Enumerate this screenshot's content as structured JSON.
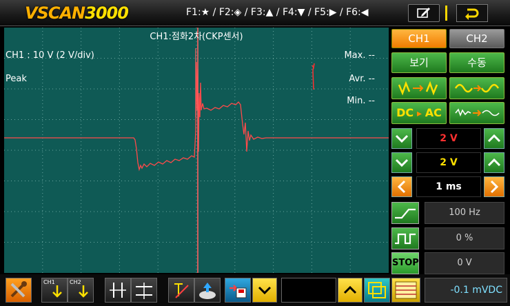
{
  "header": {
    "logo_v": "V",
    "logo_text": "SCAN",
    "logo_num": "3000",
    "fkeys": "F1:★ / F2:◈ / F3:▲ / F4:▼ / F5:▶ / F6:◀",
    "edit_icon": "edit-icon",
    "back_icon": "return-icon"
  },
  "scope": {
    "title": "CH1:점화2차(CKP센서)",
    "volt_label": "CH1 : 10 V (2 V/div)",
    "mode_label": "Peak",
    "max_label": "Max. --",
    "avr_label": "Avr. --",
    "min_label": "Min. --",
    "colors": {
      "background": "#0f5a55",
      "grid": "#6aa6a0",
      "trace": "#ff4a4a"
    }
  },
  "panel": {
    "ch1_label": "CH1",
    "ch2_label": "CH2",
    "view_label": "보기",
    "manual_label": "수동",
    "dc_label": "DC",
    "ac_label": "AC",
    "volt_ch1": "2 V",
    "volt_ch2": "2 V",
    "timebase": "1 ms",
    "trigger_freq": "100 Hz",
    "duty": "0 %",
    "stop_label": "STOP",
    "level": "0 V"
  },
  "toolbar": {
    "ch1_trig": "CH1",
    "ch2_trig": "CH2",
    "mvdc": "-0.1 mVDC"
  }
}
